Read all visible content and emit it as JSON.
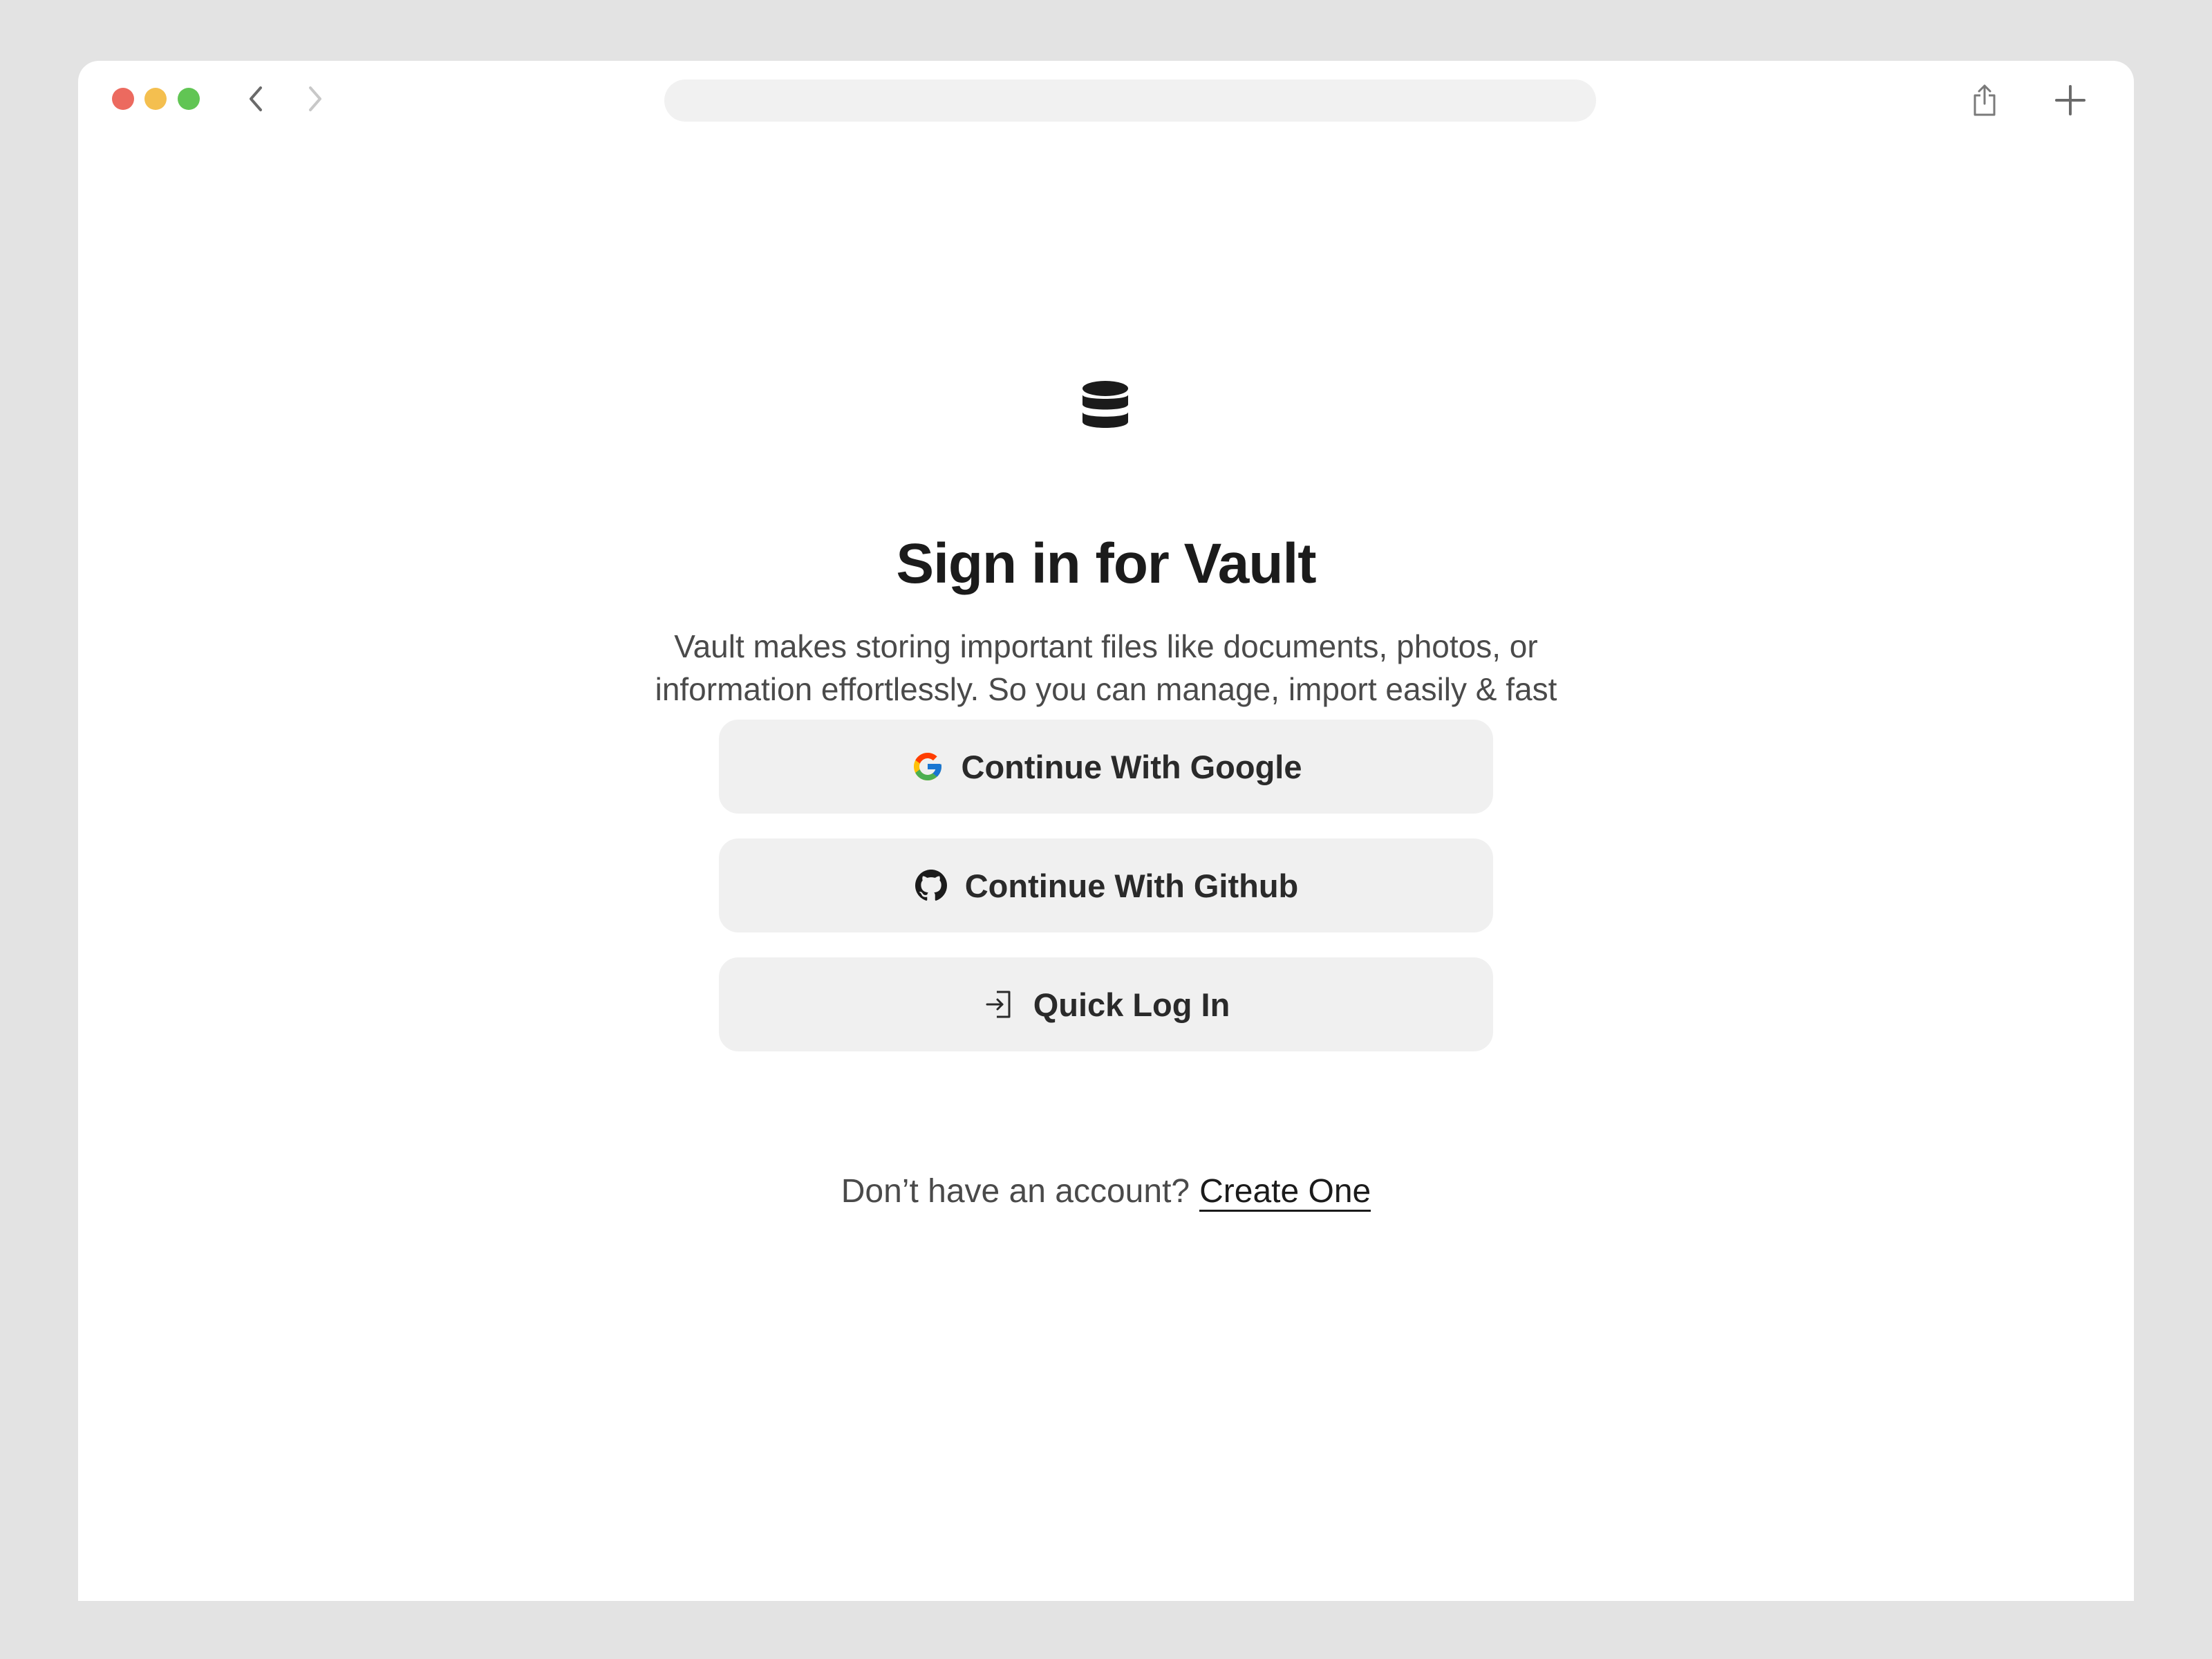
{
  "browser": {
    "address": "",
    "icons": {
      "back": "chevron-left-icon",
      "forward": "chevron-right-icon",
      "share": "share-icon",
      "new_tab": "plus-icon"
    },
    "traffic_lights": {
      "close": "#ec6a5f",
      "minimize": "#f4bf4f",
      "zoom": "#61c554"
    }
  },
  "page": {
    "logo_icon": "database-icon",
    "title": "Sign in for Vault",
    "subtitle_line1": "Vault makes storing important files like documents, photos, or",
    "subtitle_line2": "information effortlessly. So you can manage, import easily & fast",
    "buttons": [
      {
        "label": "Continue With Google",
        "icon": "google-icon"
      },
      {
        "label": "Continue With Github",
        "icon": "github-icon"
      },
      {
        "label": "Quick Log In",
        "icon": "login-icon"
      }
    ],
    "signup_prompt": "Don’t have an account?",
    "signup_link": "Create One"
  },
  "colors": {
    "background": "#e3e3e3",
    "window": "#ffffff",
    "button_bg": "#f0f0f0",
    "text_primary": "#1b1b1b",
    "text_secondary": "#4a4a4a"
  }
}
